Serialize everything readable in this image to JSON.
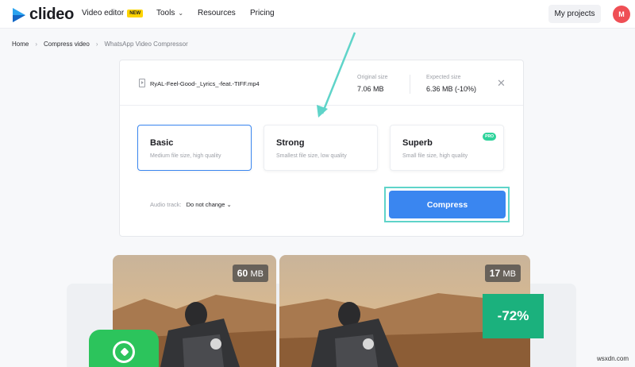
{
  "header": {
    "logo_text": "clideo",
    "nav": [
      {
        "label": "Video editor",
        "badge": "NEW"
      },
      {
        "label": "Tools"
      },
      {
        "label": "Resources"
      },
      {
        "label": "Pricing"
      }
    ],
    "my_projects": "My projects",
    "avatar_letter": "M"
  },
  "breadcrumb": [
    "Home",
    "Compress video",
    "WhatsApp Video Compressor"
  ],
  "file": {
    "name": "RyAL-Feel-Good-_Lyrics_-feat.-TIFF.mp4",
    "original_size_label": "Original size",
    "original_size": "7.06 MB",
    "expected_size_label": "Expected size",
    "expected_size": "6.36 MB (-10%)",
    "close_icon": "close-icon"
  },
  "options": [
    {
      "title": "Basic",
      "desc": "Medium file size, high quality",
      "selected": true
    },
    {
      "title": "Strong",
      "desc": "Smallest file size, low quality",
      "selected": false
    },
    {
      "title": "Superb",
      "desc": "Small file size, high quality",
      "selected": false,
      "badge": "PRO"
    }
  ],
  "audio": {
    "label": "Audio track:",
    "value": "Do not change"
  },
  "compress_label": "Compress",
  "promo": {
    "left_size": "60",
    "left_unit": "MB",
    "right_size": "17",
    "right_unit": "MB",
    "reduction": "-72%"
  },
  "colors": {
    "accent": "#3a86f0",
    "highlight": "#5fd4c9",
    "success": "#1bb17d",
    "brand_logo": "#2aa3ef"
  },
  "watermark": "wsxdn.com"
}
